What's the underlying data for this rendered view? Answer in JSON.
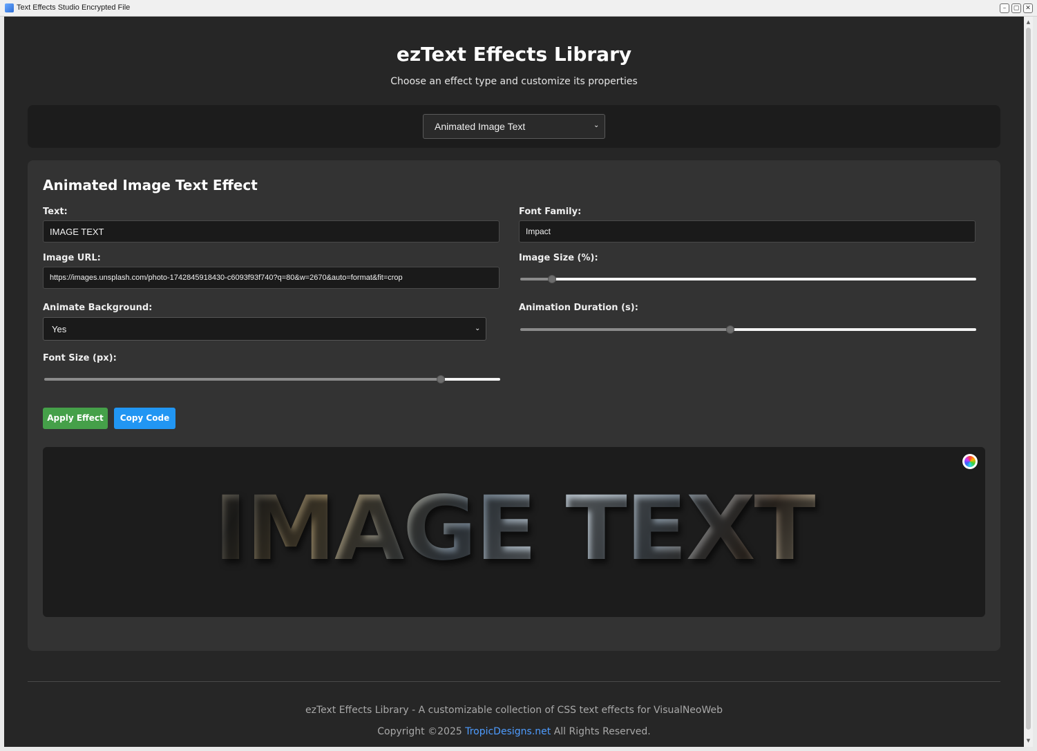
{
  "window": {
    "title": "Text Effects Studio Encrypted File",
    "minimize_glyph": "–",
    "maximize_glyph": "▢",
    "close_glyph": "✕"
  },
  "header": {
    "title": "ezText Effects Library",
    "subtitle": "Choose an effect type and customize its properties"
  },
  "effect_selector": {
    "selected": "Animated Image Text",
    "chevron": "⌄"
  },
  "editor": {
    "title": "Animated Image Text Effect",
    "fields": {
      "text": {
        "label": "Text:",
        "value": "IMAGE TEXT"
      },
      "font_family": {
        "label": "Font Family:",
        "value": "Impact"
      },
      "image_url": {
        "label": "Image URL:",
        "value": "https://images.unsplash.com/photo-1742845918430-c6093f93f740?q=80&w=2670&auto=format&fit=crop"
      },
      "image_size": {
        "label": "Image Size (%):",
        "fraction": 0.07
      },
      "animate_background": {
        "label": "Animate Background:",
        "value": "Yes"
      },
      "animation_duration": {
        "label": "Animation Duration (s):",
        "fraction": 0.46
      },
      "font_size": {
        "label": "Font Size (px):",
        "fraction": 0.87
      }
    },
    "buttons": {
      "apply": "Apply Effect",
      "copy": "Copy Code"
    }
  },
  "preview": {
    "text": "IMAGE TEXT",
    "color_picker_icon": "color-wheel"
  },
  "footer": {
    "line1": "ezText Effects Library - A customizable collection of CSS text effects for VisualNeoWeb",
    "copyright_prefix": "Copyright ©2025 ",
    "link_text": "TropicDesigns.net",
    "copyright_suffix": " All Rights Reserved."
  },
  "colors": {
    "background": "#262626",
    "panel": "#333333",
    "apply_button": "#45a049",
    "copy_button": "#2196f3",
    "link": "#4e9cff"
  }
}
